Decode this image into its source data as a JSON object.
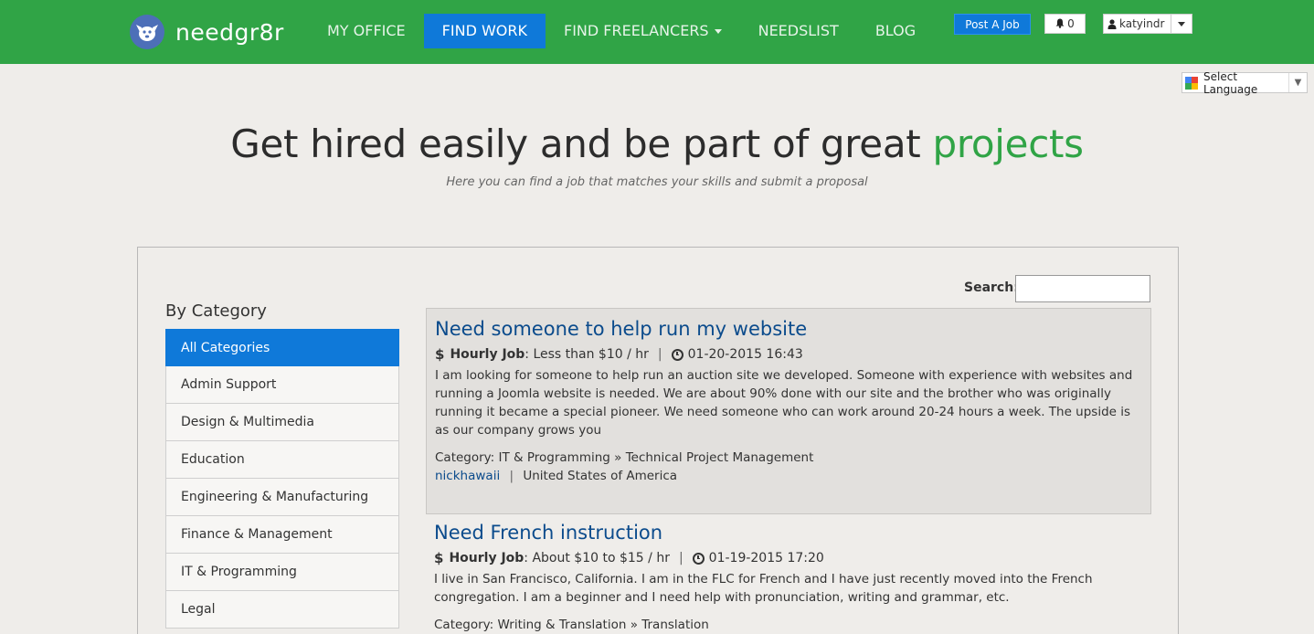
{
  "header": {
    "logo_text": "needgr8r",
    "nav": [
      {
        "label": "MY OFFICE"
      },
      {
        "label": "FIND WORK"
      },
      {
        "label": "FIND FREELANCERS"
      },
      {
        "label": "NEEDSLIST"
      },
      {
        "label": "BLOG"
      }
    ],
    "post_job_label": "Post A Job",
    "notifications_count": "0",
    "username": "katyindr"
  },
  "language": {
    "label": "Select Language"
  },
  "hero": {
    "title_main": "Get hired easily and be part of great ",
    "title_accent": "projects",
    "subtitle": "Here you can find a job that matches your skills and submit a proposal"
  },
  "search": {
    "label": "Search:",
    "value": ""
  },
  "sidebar": {
    "heading": "By Category",
    "items": [
      {
        "label": "All Categories"
      },
      {
        "label": "Admin Support"
      },
      {
        "label": "Design & Multimedia"
      },
      {
        "label": "Education"
      },
      {
        "label": "Engineering & Manufacturing"
      },
      {
        "label": "Finance & Management"
      },
      {
        "label": "IT & Programming"
      },
      {
        "label": "Legal"
      }
    ]
  },
  "jobs": [
    {
      "title": "Need someone to help run my website",
      "job_type": "Hourly Job",
      "rate": ": Less than $10 / hr",
      "date": "01-20-2015 16:43",
      "description": "I am looking for someone to help run an auction site we developed. Someone with experience with websites and running a Joomla website is needed. We are about 90% done with our site and the brother who was originally running it became a special pioneer. We need someone who can work around 20-24 hours a week. The upside is as our company grows you",
      "category": "Category: IT & Programming » Technical Project Management",
      "user": "nickhawaii",
      "country": "United States of America"
    },
    {
      "title": "Need French instruction",
      "job_type": "Hourly Job",
      "rate": ": About $10 to $15 / hr",
      "date": "01-19-2015 17:20",
      "description": "I live in San Francisco, California. I am in the FLC for French and I have just recently moved into the French congregation. I am a beginner and I need help with pronunciation, writing and grammar, etc.",
      "category": "Category: Writing & Translation » Translation"
    }
  ],
  "colors": {
    "brand_green": "#30a446",
    "nav_active_blue": "#0f79d9",
    "link_blue": "#0b4b8c"
  }
}
